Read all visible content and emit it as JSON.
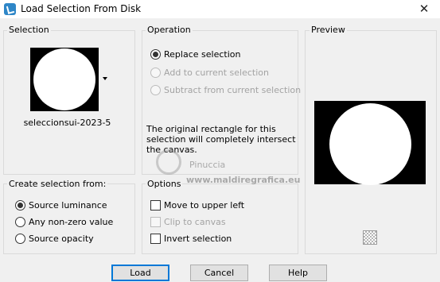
{
  "window": {
    "title": "Load Selection From Disk",
    "close_glyph": "✕",
    "icon": "selection-app-icon"
  },
  "selection": {
    "group_label": "Selection",
    "thumbnail_name": "seleccionsui-2023-5"
  },
  "operation": {
    "group_label": "Operation",
    "options": [
      {
        "label": "Replace selection",
        "selected": true,
        "enabled": true
      },
      {
        "label": "Add to current selection",
        "selected": false,
        "enabled": false
      },
      {
        "label": "Subtract from current selection",
        "selected": false,
        "enabled": false
      }
    ],
    "info_text": "The original rectangle for this selection will completely intersect the canvas."
  },
  "preview": {
    "group_label": "Preview",
    "transparency_icon": "checkerboard-icon"
  },
  "create_from": {
    "group_label": "Create selection from:",
    "options": [
      {
        "label": "Source luminance",
        "selected": true
      },
      {
        "label": "Any non-zero value",
        "selected": false
      },
      {
        "label": "Source opacity",
        "selected": false
      }
    ]
  },
  "options": {
    "group_label": "Options",
    "items": [
      {
        "label": "Move to upper left",
        "checked": false,
        "enabled": true
      },
      {
        "label": "Clip to canvas",
        "checked": false,
        "enabled": false
      },
      {
        "label": "Invert selection",
        "checked": false,
        "enabled": true
      }
    ]
  },
  "buttons": {
    "load": "Load",
    "cancel": "Cancel",
    "help": "Help"
  },
  "watermark": {
    "name": "Pinuccia",
    "site": "www.maldiregrafica.eu"
  },
  "colors": {
    "dialog_bg": "#f0f0f0",
    "default_button_border": "#0078d7"
  }
}
